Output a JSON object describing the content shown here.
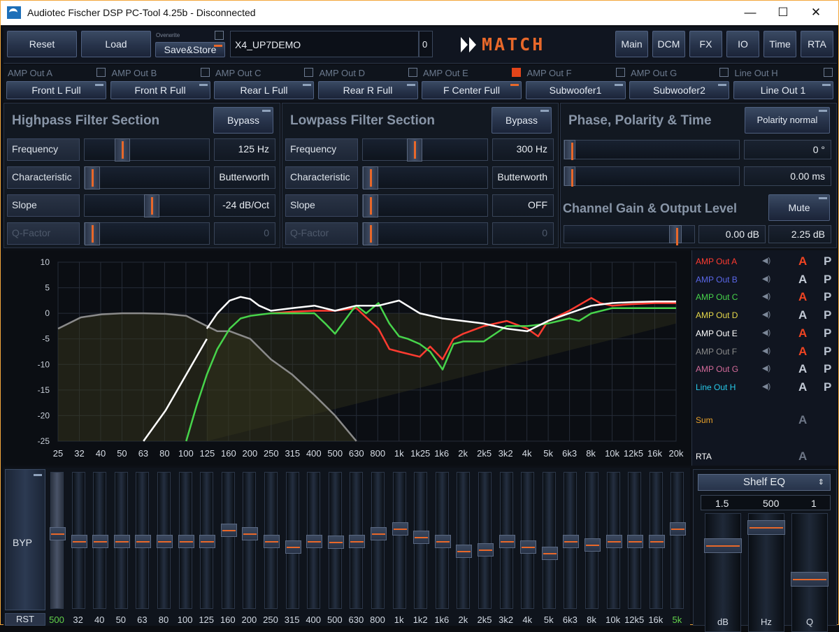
{
  "window": {
    "title": "Audiotec Fischer DSP PC-Tool 4.25b - Disconnected",
    "min": "—",
    "max": "☐",
    "close": "✕"
  },
  "toolbar": {
    "reset": "Reset",
    "load": "Load",
    "save_caption": "Overwrite",
    "save": "Save&Store",
    "preset_name": "X4_UP7DEMO",
    "preset_index": "0",
    "logo": "MATCH",
    "tabs": [
      "Main",
      "DCM",
      "FX",
      "IO",
      "Time",
      "RTA"
    ]
  },
  "channels": [
    {
      "out": "AMP Out A",
      "name": "Front L Full",
      "checked": false
    },
    {
      "out": "AMP Out B",
      "name": "Front R Full",
      "checked": false
    },
    {
      "out": "AMP Out C",
      "name": "Rear L Full",
      "checked": false
    },
    {
      "out": "AMP Out D",
      "name": "Rear R Full",
      "checked": false
    },
    {
      "out": "AMP Out E",
      "name": "F Center Full",
      "checked": true
    },
    {
      "out": "AMP Out F",
      "name": "Subwoofer1",
      "checked": false
    },
    {
      "out": "AMP Out G",
      "name": "Subwoofer2",
      "checked": false
    },
    {
      "out": "Line Out H",
      "name": "Line Out 1",
      "checked": false
    }
  ],
  "highpass": {
    "title": "Highpass Filter Section",
    "bypass": "Bypass",
    "rows": [
      {
        "label": "Frequency",
        "value": "125 Hz",
        "level": 0.27
      },
      {
        "label": "Characteristic",
        "value": "Butterworth",
        "level": 0
      },
      {
        "label": "Slope",
        "value": "-24 dB/Oct",
        "level": 0.54
      },
      {
        "label": "Q-Factor",
        "value": "0",
        "level": 0
      }
    ]
  },
  "lowpass": {
    "title": "Lowpass Filter Section",
    "bypass": "Bypass",
    "rows": [
      {
        "label": "Frequency",
        "value": "300 Hz",
        "level": 0.4
      },
      {
        "label": "Characteristic",
        "value": "Butterworth",
        "level": 0
      },
      {
        "label": "Slope",
        "value": "OFF",
        "level": 0
      },
      {
        "label": "Q-Factor",
        "value": "0",
        "level": 0
      }
    ]
  },
  "phase": {
    "title": "Phase, Polarity & Time",
    "polarity": "Polarity normal",
    "rows": [
      {
        "value": "0 °",
        "level": 0
      },
      {
        "value": "0.00 ms",
        "level": 0
      }
    ]
  },
  "gain": {
    "title": "Channel Gain & Output Level",
    "mute": "Mute",
    "gain": "0.00 dB",
    "level_value": "2.25 dB",
    "level": 0.88
  },
  "chart_data": {
    "type": "line",
    "x_ticks": [
      "25",
      "32",
      "40",
      "50",
      "63",
      "80",
      "100",
      "125",
      "160",
      "200",
      "250",
      "315",
      "400",
      "500",
      "630",
      "800",
      "1k",
      "1k25",
      "1k6",
      "2k",
      "2k5",
      "3k2",
      "4k",
      "5k",
      "6k3",
      "8k",
      "10k",
      "12k5",
      "16k",
      "20k"
    ],
    "y_ticks": [
      10,
      5,
      0,
      -5,
      -10,
      -15,
      -20,
      -25
    ],
    "ylim": [
      -25,
      10
    ],
    "series": [
      {
        "name": "AMP Out E",
        "color": "#ffffff",
        "x": [
          125,
          140,
          160,
          180,
          200,
          220,
          250,
          315,
          400,
          500,
          630,
          800,
          1000,
          1250,
          1600,
          2000,
          2500,
          3200,
          4000,
          5000,
          6300,
          8000,
          10000,
          12500,
          16000,
          20000
        ],
        "y": [
          -3,
          0,
          2.5,
          3.2,
          2.8,
          1.5,
          0.5,
          1,
          1.5,
          0.5,
          1.5,
          1.5,
          2.5,
          0,
          -1,
          -1.5,
          -2,
          -3,
          -3.5,
          -1.5,
          0,
          1.5,
          2,
          2.2,
          2.3,
          2.3
        ]
      },
      {
        "name": "AMP Out A",
        "color": "#ff3b30",
        "x": [
          250,
          315,
          400,
          500,
          630,
          800,
          900,
          1000,
          1250,
          1400,
          1600,
          1800,
          2000,
          2500,
          3200,
          4000,
          4500,
          5000,
          6300,
          8000,
          8800,
          10000,
          12500,
          16000,
          20000
        ],
        "y": [
          0,
          0.3,
          0.5,
          0.5,
          1,
          -3,
          -7,
          -7.5,
          -8.5,
          -6.5,
          -9,
          -5,
          -4,
          -2.5,
          -1.5,
          -3,
          -4.5,
          -1.5,
          0.5,
          3,
          2,
          1.5,
          1.8,
          2,
          2
        ]
      },
      {
        "name": "AMP Out C",
        "color": "#47d44b",
        "x": [
          100,
          112,
          125,
          140,
          160,
          180,
          200,
          250,
          315,
          400,
          450,
          500,
          600,
          630,
          700,
          800,
          900,
          1000,
          1100,
          1250,
          1400,
          1600,
          1800,
          2000,
          2500,
          3200,
          4000,
          5000,
          6300,
          7000,
          8000,
          10000,
          12500,
          16000,
          20000
        ],
        "y": [
          -25,
          -18,
          -12,
          -7,
          -3,
          -1,
          -0.5,
          0,
          0,
          0,
          -2,
          -4,
          0.5,
          1.5,
          0,
          2,
          -2,
          -4.5,
          -5,
          -6,
          -7.5,
          -11,
          -6,
          -5.5,
          -5.5,
          -2.5,
          -2.5,
          -2,
          -1,
          -1.5,
          0,
          1,
          1,
          1,
          1
        ]
      },
      {
        "name": "AMP Out F",
        "color": "#8a8a8a",
        "x": [
          25,
          32,
          40,
          50,
          63,
          80,
          100,
          112,
          125,
          140,
          160,
          200,
          250,
          315,
          400,
          500,
          630
        ],
        "y": [
          -3,
          -0.8,
          -0.2,
          0,
          0,
          -0.1,
          -0.5,
          -1.5,
          -2.5,
          -3.5,
          -3.5,
          -5,
          -9,
          -12,
          -16,
          -20,
          -25
        ]
      }
    ]
  },
  "legend": [
    {
      "name": "AMP Out A",
      "color": "#ff3b30",
      "a_active": true
    },
    {
      "name": "AMP Out B",
      "color": "#5a67e8",
      "a_active": false
    },
    {
      "name": "AMP Out C",
      "color": "#47d44b",
      "a_active": true
    },
    {
      "name": "AMP Out D",
      "color": "#e6d84a",
      "a_active": false
    },
    {
      "name": "AMP Out E",
      "color": "#ffffff",
      "a_active": true
    },
    {
      "name": "AMP Out F",
      "color": "#8a8a8a",
      "a_active": true
    },
    {
      "name": "AMP Out G",
      "color": "#d36a9a",
      "a_active": false
    },
    {
      "name": "Line Out H",
      "color": "#27c8e8",
      "a_active": false
    }
  ],
  "legend_a": "A",
  "legend_p": "P",
  "sum": "Sum",
  "rta": "RTA",
  "eq": {
    "byp": "BYP",
    "rst": "RST",
    "bands": [
      {
        "label": "500",
        "level": 0.56,
        "green": true
      },
      {
        "label": "32",
        "level": 0.5
      },
      {
        "label": "40",
        "level": 0.5
      },
      {
        "label": "50",
        "level": 0.5
      },
      {
        "label": "63",
        "level": 0.5
      },
      {
        "label": "80",
        "level": 0.5
      },
      {
        "label": "100",
        "level": 0.5
      },
      {
        "label": "125",
        "level": 0.5
      },
      {
        "label": "160",
        "level": 0.59
      },
      {
        "label": "200",
        "level": 0.56
      },
      {
        "label": "250",
        "level": 0.5
      },
      {
        "label": "315",
        "level": 0.45
      },
      {
        "label": "400",
        "level": 0.5
      },
      {
        "label": "500",
        "level": 0.49
      },
      {
        "label": "630",
        "level": 0.5
      },
      {
        "label": "800",
        "level": 0.56
      },
      {
        "label": "1k",
        "level": 0.6
      },
      {
        "label": "1k2",
        "level": 0.53
      },
      {
        "label": "1k6",
        "level": 0.5
      },
      {
        "label": "2k",
        "level": 0.42
      },
      {
        "label": "2k5",
        "level": 0.43
      },
      {
        "label": "3k2",
        "level": 0.5
      },
      {
        "label": "4k",
        "level": 0.45
      },
      {
        "label": "5k",
        "level": 0.4
      },
      {
        "label": "6k3",
        "level": 0.5
      },
      {
        "label": "8k",
        "level": 0.47
      },
      {
        "label": "10k",
        "level": 0.5
      },
      {
        "label": "12k5",
        "level": 0.5
      },
      {
        "label": "16k",
        "level": 0.5
      },
      {
        "label": "5k",
        "level": 0.6,
        "green": true
      }
    ]
  },
  "shelf": {
    "mode": "Shelf EQ",
    "values": [
      "1.5",
      "500",
      "1"
    ],
    "labels": [
      "dB",
      "Hz",
      "Q"
    ],
    "levels": [
      0.77,
      0.94,
      0.45
    ]
  }
}
